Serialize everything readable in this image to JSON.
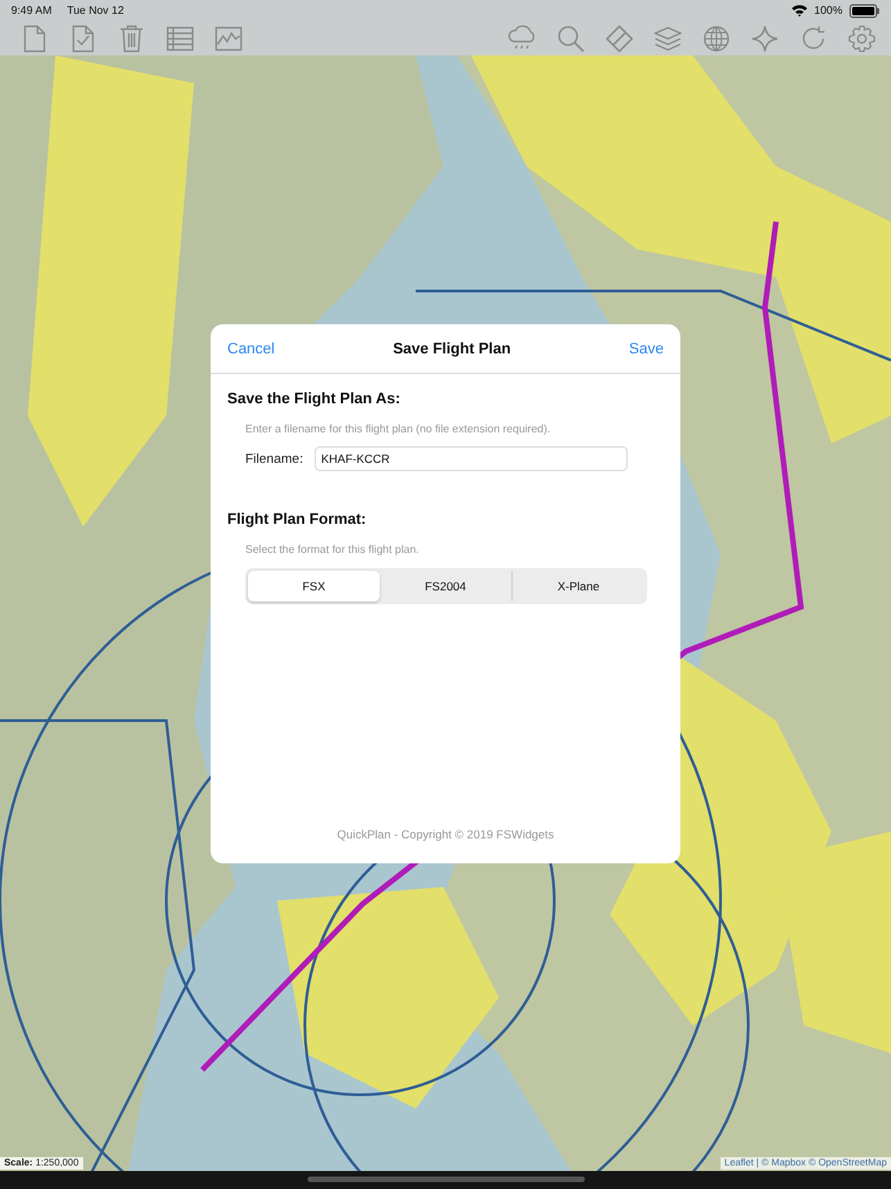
{
  "status_bar": {
    "time": "9:49 AM",
    "date": "Tue Nov 12",
    "battery": "100%"
  },
  "dialog": {
    "cancel": "Cancel",
    "title": "Save Flight Plan",
    "save": "Save",
    "name_section": {
      "heading": "Save the Flight Plan As:",
      "hint": "Enter a filename for this flight plan (no file extension required).",
      "field_label": "Filename:",
      "field_value": "KHAF-KCCR"
    },
    "format_section": {
      "heading": "Flight Plan Format:",
      "hint": "Select the format for this flight plan.",
      "formats": [
        {
          "label": "FSX",
          "selected": true
        },
        {
          "label": "FS2004",
          "selected": false
        },
        {
          "label": "X-Plane",
          "selected": false
        }
      ]
    },
    "footer": "QuickPlan - Copyright © 2019 FSWidgets"
  },
  "map": {
    "scale": "**Scale:** 1:250,000",
    "attribution": "Leaflet | © Mapbox © OpenStreetMap"
  }
}
